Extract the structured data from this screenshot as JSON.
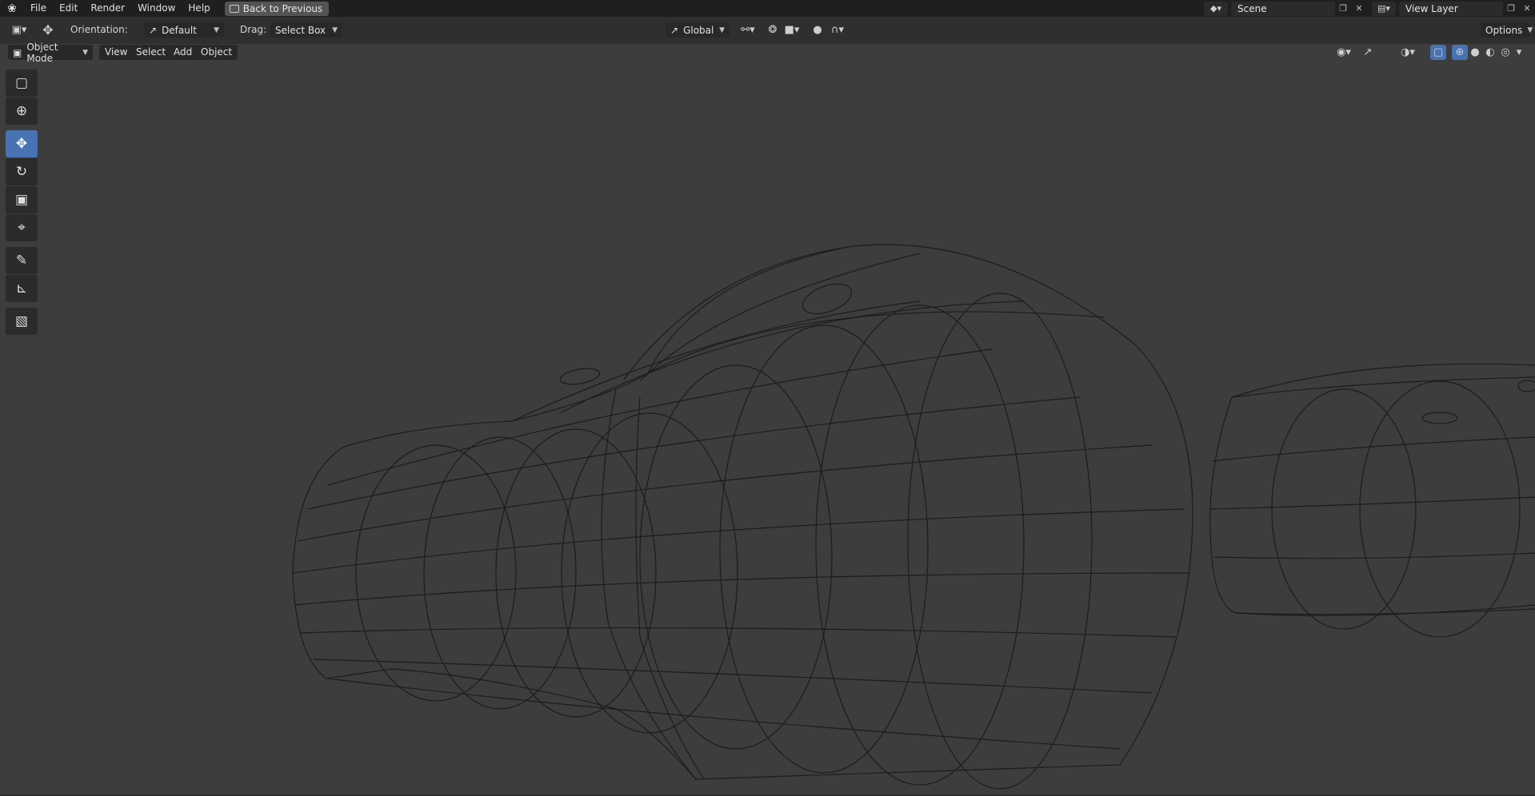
{
  "topbar": {
    "menus": [
      "File",
      "Edit",
      "Render",
      "Window",
      "Help"
    ],
    "back_button": "Back to Previous",
    "scene_name": "Scene",
    "view_layer_name": "View Layer"
  },
  "tool_header": {
    "orientation_label": "Orientation:",
    "orientation_value": "Default",
    "drag_label": "Drag:",
    "drag_value": "Select Box",
    "transform_orientation": "Global",
    "options_label": "Options"
  },
  "view_header": {
    "mode": "Object Mode",
    "menus": [
      "View",
      "Select",
      "Add",
      "Object"
    ]
  },
  "toolbar": {
    "tools": [
      "select-box-icon",
      "cursor-icon",
      "move-icon",
      "rotate-icon",
      "scale-icon",
      "transform-icon",
      "annotate-icon",
      "measure-icon",
      "add-cube-icon"
    ],
    "active_tool": "move-icon"
  },
  "colors": {
    "accent": "#4772b3",
    "viewport_bg": "#3d3d3d",
    "header_bg": "#2f2f2f",
    "topbar_bg": "#1f1f1f",
    "wire": "#1a1a1a"
  }
}
